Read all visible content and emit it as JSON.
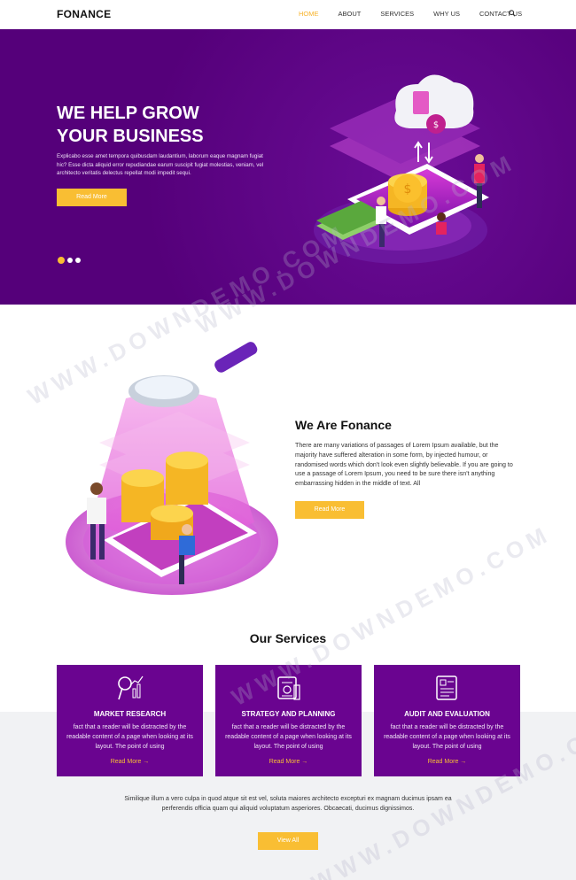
{
  "nav": {
    "logo": "FONANCE",
    "items": [
      {
        "label": "HOME",
        "active": true
      },
      {
        "label": "ABOUT"
      },
      {
        "label": "SERVICES"
      },
      {
        "label": "WHY US"
      },
      {
        "label": "CONTACT US"
      }
    ],
    "search_icon": "search-icon"
  },
  "hero": {
    "title_line1": "WE HELP GROW",
    "title_line2": "YOUR BUSINESS",
    "text": "Explicabo esse amet tempora quibusdam laudantium, laborum eaque magnam fugiat hic? Esse dicta aliquid error repudiandae earum suscipit fugiat molestias, veniam, vel architecto veritatis delectus repellat modi impedit sequi.",
    "button": "Read More",
    "slides": 3,
    "active_slide": 1
  },
  "about": {
    "title": "We Are Fonance",
    "text": "There are many variations of passages of Lorem Ipsum available, but the majority have suffered alteration in some form, by injected humour, or randomised words which don't look even slightly believable. If you are going to use a passage of Lorem Ipsum, you need to be sure there isn't anything embarrassing hidden in the middle of text. All",
    "button": "Read More"
  },
  "services": {
    "title": "Our Services",
    "cards": [
      {
        "icon": "market-research-icon",
        "title": "MARKET RESEARCH",
        "text": "fact that a reader will be distracted by the readable content of a page when looking at its layout. The point of using",
        "link": "Read More →"
      },
      {
        "icon": "strategy-planning-icon",
        "title": "STRATEGY AND PLANNING",
        "text": "fact that a reader will be distracted by the readable content of a page when looking at its layout. The point of using",
        "link": "Read More →"
      },
      {
        "icon": "audit-evaluation-icon",
        "title": "AUDIT AND EVALUATION",
        "text": "fact that a reader will be distracted by the readable content of a page when looking at its layout. The point of using",
        "link": "Read More →"
      }
    ],
    "bottom_text": "Similique illum a vero culpa in quod atque sit est vel, soluta maiores architecto excepturi ex magnam ducimus ipsam ea perferendis officia quam qui aliquid voluptatum asperiores. Obcaecati, ducimus dignissimos.",
    "view_all": "View All"
  },
  "watermark": "WWW.DOWNDEMO.COM",
  "colors": {
    "accent": "#f9be33",
    "purple": "#55007a",
    "card": "#6a0490",
    "grey": "#f1f2f4"
  }
}
